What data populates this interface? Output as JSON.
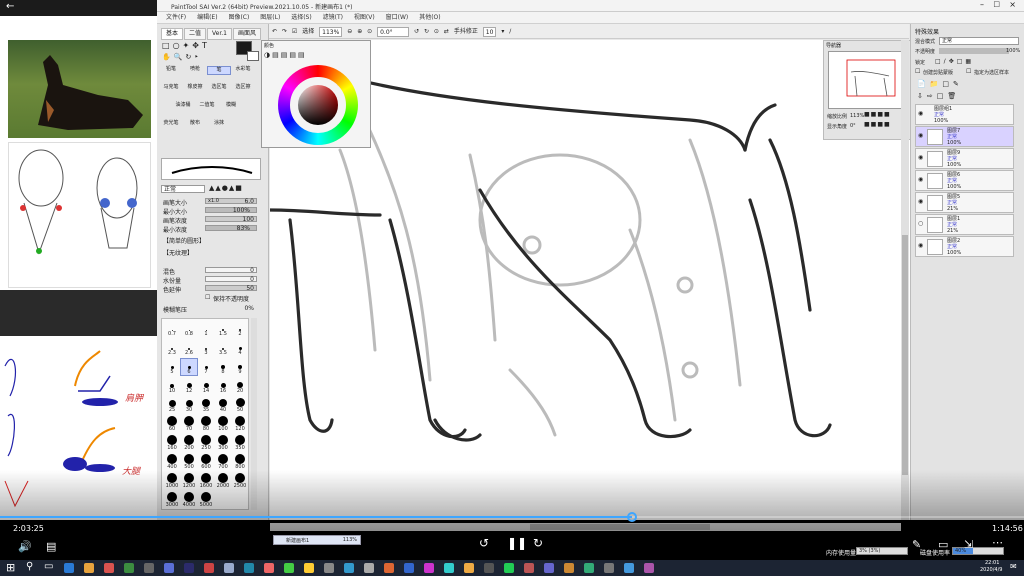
{
  "video": {
    "current_time": "2:03:25",
    "duration": "1:14:56",
    "progress": 0.617
  },
  "reference": {
    "handwriting_1": "肩胛",
    "handwriting_2": "大腿"
  },
  "sai": {
    "title": "PaintTool SAI Ver.2 (64bit) Preview.2021.10.05 - 新建画布1 (*)",
    "menu": [
      "文件(F)",
      "编辑(E)",
      "图像(C)",
      "图层(L)",
      "选择(S)",
      "滤镜(T)",
      "视图(V)",
      "窗口(W)",
      "其他(O)"
    ],
    "toolbar": {
      "selection_label": "选择",
      "zoom": "113%",
      "angle": "0.0°",
      "stabilizer_label": "手抖修正",
      "stabilizer_value": "10"
    },
    "tool_tabs": [
      "基本",
      "二值",
      "Ver.1",
      "画面风"
    ],
    "tools": [
      {
        "name": "铅笔"
      },
      {
        "name": "喷枪"
      },
      {
        "name": "笔"
      },
      {
        "name": "水彩笔"
      },
      {
        "name": "马克笔"
      },
      {
        "name": "橡皮擦"
      },
      {
        "name": "选区笔"
      },
      {
        "name": "选区擦"
      },
      {
        "name": "油漆桶"
      },
      {
        "name": "二值笔"
      },
      {
        "name": "模糊"
      },
      {
        "name": "荧光笔"
      },
      {
        "name": "散布"
      },
      {
        "name": "涂抹"
      }
    ],
    "brush": {
      "blend_mode": "正常",
      "size_label": "画笔大小",
      "size_mult": "x1.0",
      "size_value": "6.0",
      "min_size_label": "最小大小",
      "min_size_value": "100%",
      "density_label": "画笔浓度",
      "density_value": "100",
      "min_density_label": "最小浓度",
      "min_density_value": "83%",
      "shape": "【简单的圆形】",
      "texture": "【无纹理】",
      "blending_label": "混色",
      "blending_value": "0",
      "water_label": "水份量",
      "water_value": "0",
      "color_extend_label": "色延伸",
      "color_extend_value": "50",
      "keep_opacity_label": "保持不透明度",
      "pressure_label": "模糊笔压",
      "pressure_value": "0%"
    },
    "brush_sizes": [
      "0.7",
      "0.8",
      "1",
      "1.5",
      "2",
      "2.3",
      "2.6",
      "3",
      "3.5",
      "4",
      "5",
      "6",
      "7",
      "8",
      "9",
      "10",
      "12",
      "14",
      "16",
      "20",
      "25",
      "30",
      "35",
      "40",
      "50",
      "60",
      "70",
      "80",
      "100",
      "120",
      "160",
      "200",
      "250",
      "300",
      "350",
      "400",
      "500",
      "600",
      "700",
      "800",
      "1000",
      "1200",
      "1600",
      "2000",
      "2500",
      "3000",
      "4000",
      "5000"
    ],
    "color_panel_title": "颜色",
    "navigator": {
      "title": "导航器",
      "zoom_label": "缩放比例",
      "zoom_value": "113%",
      "angle_label": "显示角度",
      "angle_value": "0°"
    },
    "layer_panel": {
      "header": "特殊效果",
      "blend_label": "混合模式",
      "blend_value": "正常",
      "opacity_label": "不透明度",
      "opacity_value": "100%",
      "lock_label": "锁定",
      "clip_label": "创建剪贴蒙版",
      "select_source_label": "指定为选区样本",
      "layers": [
        {
          "name": "图层组1",
          "mode": "正常",
          "opacity": "100%",
          "selected": false
        },
        {
          "name": "图层7",
          "mode": "正常",
          "opacity": "100%",
          "selected": true
        },
        {
          "name": "图层9",
          "mode": "正常",
          "opacity": "100%",
          "selected": false
        },
        {
          "name": "图层6",
          "mode": "正常",
          "opacity": "100%",
          "selected": false
        },
        {
          "name": "图层5",
          "mode": "正常",
          "opacity": "21%",
          "selected": false
        },
        {
          "name": "图层1",
          "mode": "正常",
          "opacity": "21%",
          "selected": false
        },
        {
          "name": "图层2",
          "mode": "正常",
          "opacity": "100%",
          "selected": false
        }
      ]
    },
    "status": {
      "tab": "新建画布1",
      "tab_zoom": "113%",
      "memory_label": "内存使用量",
      "memory_value": "3% (3%)",
      "drive_label": "磁盘使用率",
      "drive_value": "40%"
    }
  },
  "taskbar": {
    "time": "22:01",
    "date": "2020/4/9"
  },
  "colors": {
    "accent": "#3ea6ff",
    "selected_layer": "#d9d2ff"
  }
}
